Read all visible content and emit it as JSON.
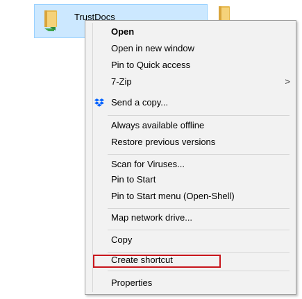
{
  "explorer": {
    "folder_name": "TrustDocs",
    "folder_icon": "folder-sync-icon",
    "second_folder_icon": "folder-icon"
  },
  "menu": {
    "items": [
      {
        "label": "Open",
        "bold": true
      },
      {
        "label": "Open in new window"
      },
      {
        "label": "Pin to Quick access"
      },
      {
        "label": "7-Zip",
        "submenu": true
      },
      {
        "label": "Send a copy...",
        "icon": "dropbox-icon"
      },
      {
        "label": "Always available offline"
      },
      {
        "label": "Restore previous versions"
      },
      {
        "label": "Scan for Viruses..."
      },
      {
        "label": "Pin to Start"
      },
      {
        "label": "Pin to Start menu (Open-Shell)"
      },
      {
        "label": "Map network drive..."
      },
      {
        "label": "Copy"
      },
      {
        "label": "Create shortcut",
        "highlighted": true
      },
      {
        "label": "Properties"
      }
    ],
    "submenu_indicator": ">"
  },
  "colors": {
    "selection_bg": "#cce8ff",
    "menu_bg": "#f2f2f2",
    "highlight_border": "#c8151b",
    "dropbox_blue": "#0061fe"
  }
}
